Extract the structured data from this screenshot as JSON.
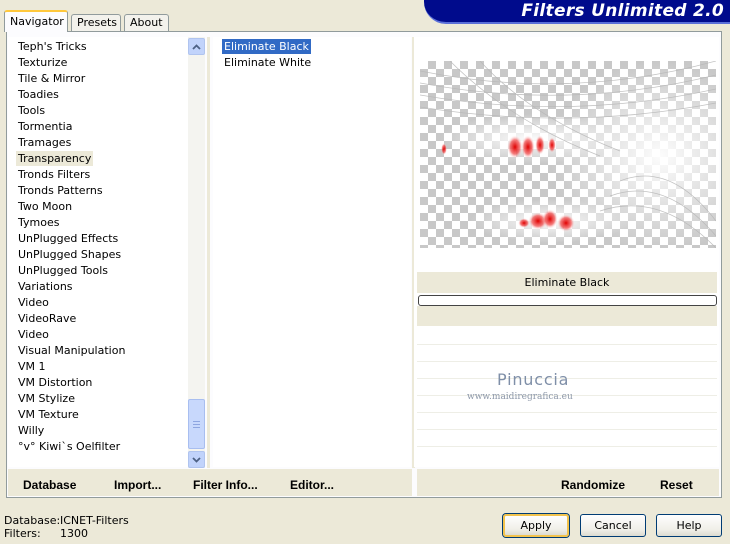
{
  "tabs": [
    {
      "label": "Navigator",
      "active": true
    },
    {
      "label": "Presets",
      "active": false
    },
    {
      "label": "About",
      "active": false
    }
  ],
  "banner": {
    "title": "Filters Unlimited 2.0"
  },
  "categories": {
    "items": [
      "Teph's Tricks",
      "Texturize",
      "Tile & Mirror",
      "Toadies",
      "Tools",
      "Tormentia",
      "Tramages",
      "Transparency",
      "Tronds Filters",
      "Tronds Patterns",
      "Two Moon",
      "Tymoes",
      "UnPlugged Effects",
      "UnPlugged Shapes",
      "UnPlugged Tools",
      "Variations",
      "Video",
      "VideoRave",
      "Video",
      "Visual Manipulation",
      "VM 1",
      "VM Distortion",
      "VM Stylize",
      "VM Texture",
      "Willy",
      "°v° Kiwi`s Oelfilter"
    ],
    "selected": "Transparency"
  },
  "filters": {
    "items": [
      "Eliminate Black",
      "Eliminate White"
    ],
    "selected": "Eliminate Black"
  },
  "preview": {
    "filter_name": "Eliminate Black",
    "watermark": "Pinuccia",
    "watermark_url": "www.maidiregrafica.eu"
  },
  "bottom_links": {
    "database": "Database",
    "import": "Import...",
    "filter_info": "Filter Info...",
    "editor": "Editor...",
    "randomize": "Randomize",
    "reset": "Reset"
  },
  "status": {
    "database_label": "Database:",
    "database_value": "ICNET-Filters",
    "filters_label": "Filters:",
    "filters_value": "1300"
  },
  "buttons": {
    "apply": "Apply",
    "cancel": "Cancel",
    "help": "Help"
  },
  "colors": {
    "selection": "#316ac5",
    "banner": "#000b8c",
    "dialog": "#ece9d8",
    "accent_red": "#e00000"
  }
}
